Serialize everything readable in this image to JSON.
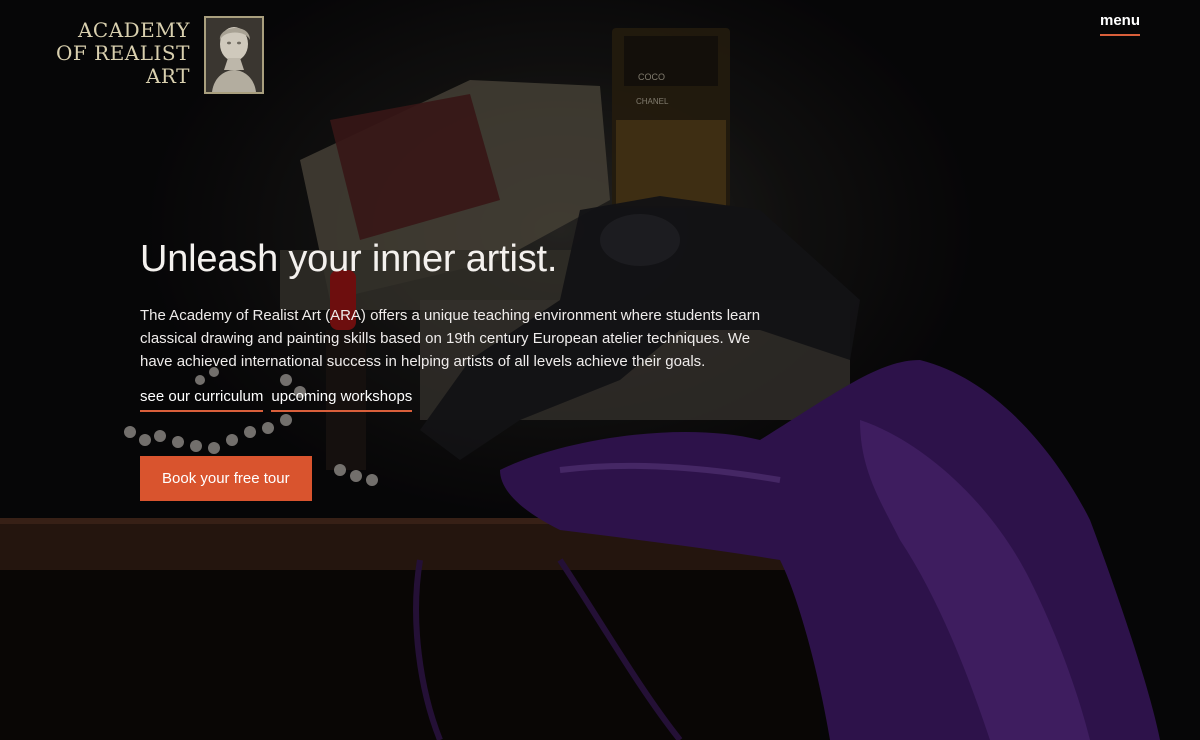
{
  "header": {
    "logo_lines": [
      "ACADEMY",
      "OF REALIST",
      "ART"
    ],
    "logo_icon": "classical-bust-icon",
    "menu_label": "menu"
  },
  "hero": {
    "headline": "Unleash your inner artist.",
    "intro": "The Academy of Realist Art (ARA) offers a unique teaching environment where students learn classical drawing and painting skills based on 19th century European atelier techniques. We have achieved international success in helping artists of all levels achieve their goals.",
    "links": [
      "see our curriculum",
      "upcoming workshops"
    ],
    "cta_label": "Book your free tour",
    "background_labels": [
      "COCO",
      "CHANEL"
    ]
  },
  "colors": {
    "accent": "#d9542e",
    "logo_gold": "#d8cfae",
    "background": "#0b0a0c"
  }
}
